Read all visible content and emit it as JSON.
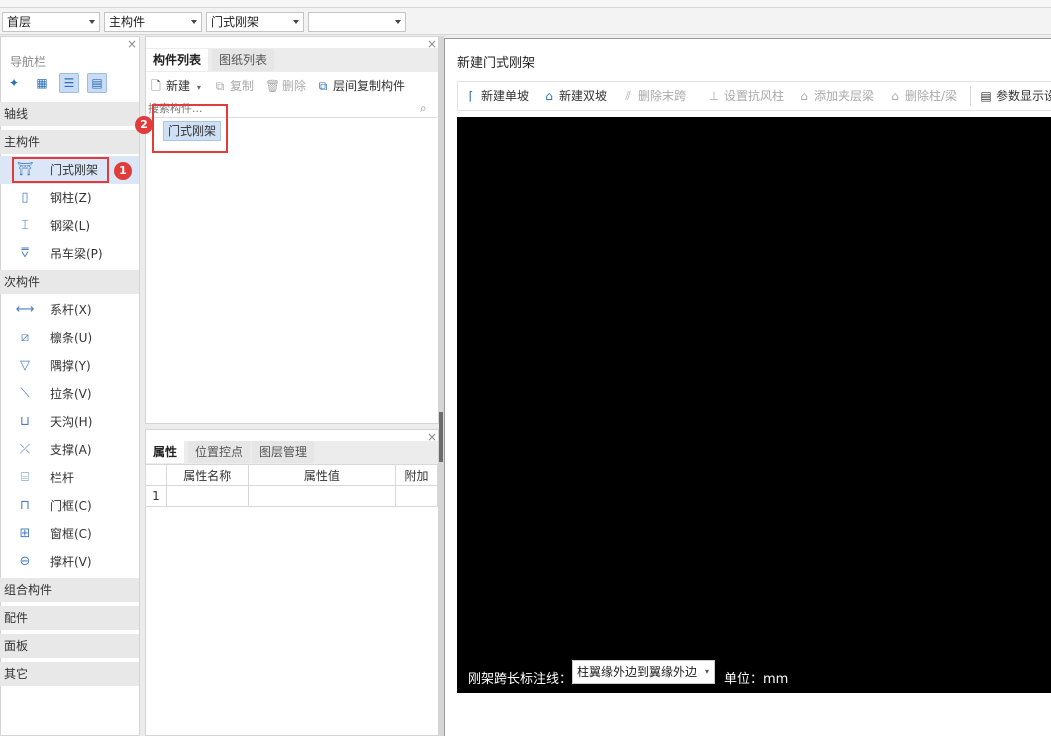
{
  "toolbar": {
    "floor": "首层",
    "type": "主构件",
    "component": "门式刚架",
    "blank": ""
  },
  "nav": {
    "title": "导航栏",
    "close": "×",
    "categories": {
      "axis": "轴线",
      "main": "主构件",
      "secondary": "次构件",
      "composite": "组合构件",
      "accessory": "配件",
      "panel": "面板",
      "other": "其它"
    },
    "main_items": [
      {
        "label": "门式刚架",
        "icon": "portal-frame-icon"
      },
      {
        "label": "钢柱(Z)",
        "icon": "steel-column-icon"
      },
      {
        "label": "钢梁(L)",
        "icon": "steel-beam-icon"
      },
      {
        "label": "吊车梁(P)",
        "icon": "crane-beam-icon"
      }
    ],
    "secondary_items": [
      {
        "label": "系杆(X)",
        "icon": "tie-rod-icon"
      },
      {
        "label": "檩条(U)",
        "icon": "purlin-icon"
      },
      {
        "label": "隅撑(Y)",
        "icon": "corner-brace-icon"
      },
      {
        "label": "拉条(V)",
        "icon": "tie-bar-icon"
      },
      {
        "label": "天沟(H)",
        "icon": "gutter-icon"
      },
      {
        "label": "支撑(A)",
        "icon": "bracing-icon"
      },
      {
        "label": "栏杆",
        "icon": "railing-icon"
      },
      {
        "label": "门框(C)",
        "icon": "door-frame-icon"
      },
      {
        "label": "窗框(C)",
        "icon": "window-frame-icon"
      },
      {
        "label": "撑杆(V)",
        "icon": "strut-icon"
      }
    ]
  },
  "component_panel": {
    "tabs": [
      "构件列表",
      "图纸列表"
    ],
    "actions": {
      "new": "新建",
      "copy": "复制",
      "delete": "删除",
      "floor_copy": "层间复制构件"
    },
    "search_placeholder": "搜索构件...",
    "items": [
      "门式刚架"
    ]
  },
  "badges": {
    "one": "1",
    "two": "2"
  },
  "property_panel": {
    "tabs": [
      "属性",
      "位置控点",
      "图层管理"
    ],
    "columns": [
      "属性名称",
      "属性值",
      "附加"
    ],
    "rows": [
      {
        "index": "1",
        "name": "",
        "value": "",
        "extra": ""
      }
    ]
  },
  "dialog": {
    "title": "新建门式刚架",
    "toolbar": {
      "new_single": "新建单坡",
      "new_double": "新建双坡",
      "delete_last_span": "删除末跨",
      "set_wind_column": "设置抗风柱",
      "add_mezzanine_beam": "添加夹层梁",
      "delete_column_beam": "删除柱/梁",
      "param_display": "参数显示设"
    },
    "span_label": "刚架跨长标注线：",
    "span_option": "柱翼缘外边到翼缘外边",
    "unit_label": "单位：mm"
  },
  "colors": {
    "accent": "#2a6fb7",
    "highlight": "#e23b3b",
    "canvas": "#000000"
  }
}
